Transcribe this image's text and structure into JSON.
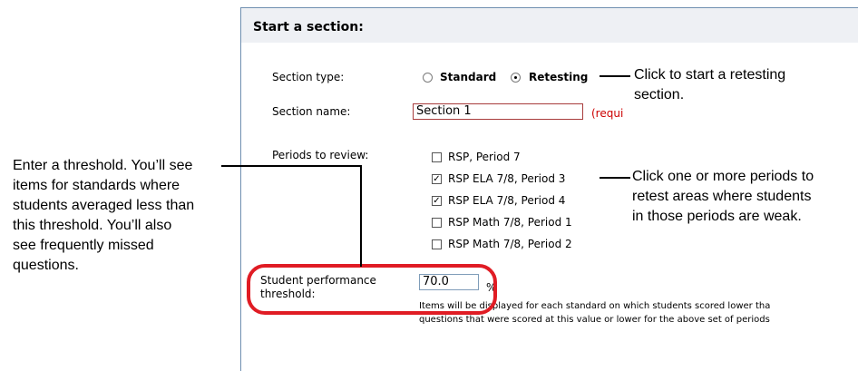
{
  "panel": {
    "title": "Start a section:",
    "section_type": {
      "label": "Section type:",
      "options": [
        {
          "label": "Standard",
          "selected": false
        },
        {
          "label": "Retesting",
          "selected": true
        }
      ]
    },
    "section_name": {
      "label": "Section name:",
      "value": "Section 1",
      "required_note": "(requi"
    },
    "periods": {
      "label": "Periods to review:",
      "items": [
        {
          "label": "RSP, Period 7",
          "checked": false
        },
        {
          "label": "RSP ELA 7/8, Period 3",
          "checked": true
        },
        {
          "label": "RSP ELA 7/8, Period 4",
          "checked": true
        },
        {
          "label": "RSP Math 7/8, Period 1",
          "checked": false
        },
        {
          "label": "RSP Math 7/8, Period 2",
          "checked": false
        }
      ]
    },
    "threshold": {
      "label_line1": "Student performance",
      "label_line2": "threshold:",
      "value": "70.0",
      "unit": "%",
      "note_line1": "Items will be displayed for each standard on which students scored lower tha",
      "note_line2": "questions that were scored at this value or lower for the above set of periods"
    }
  },
  "callouts": {
    "retesting": [
      "Click to start a retesting",
      "section."
    ],
    "periods": [
      "Click one or more periods to",
      "retest areas where students",
      "in those periods are weak."
    ],
    "threshold": [
      "Enter a threshold. You’ll see",
      "items for standards where",
      "students averaged less than",
      "this threshold. You’ll also",
      "see frequently missed",
      "questions."
    ]
  },
  "colors": {
    "highlight": "#e01c24",
    "panel_border": "#6f8fb0",
    "required": "#cc0000"
  }
}
